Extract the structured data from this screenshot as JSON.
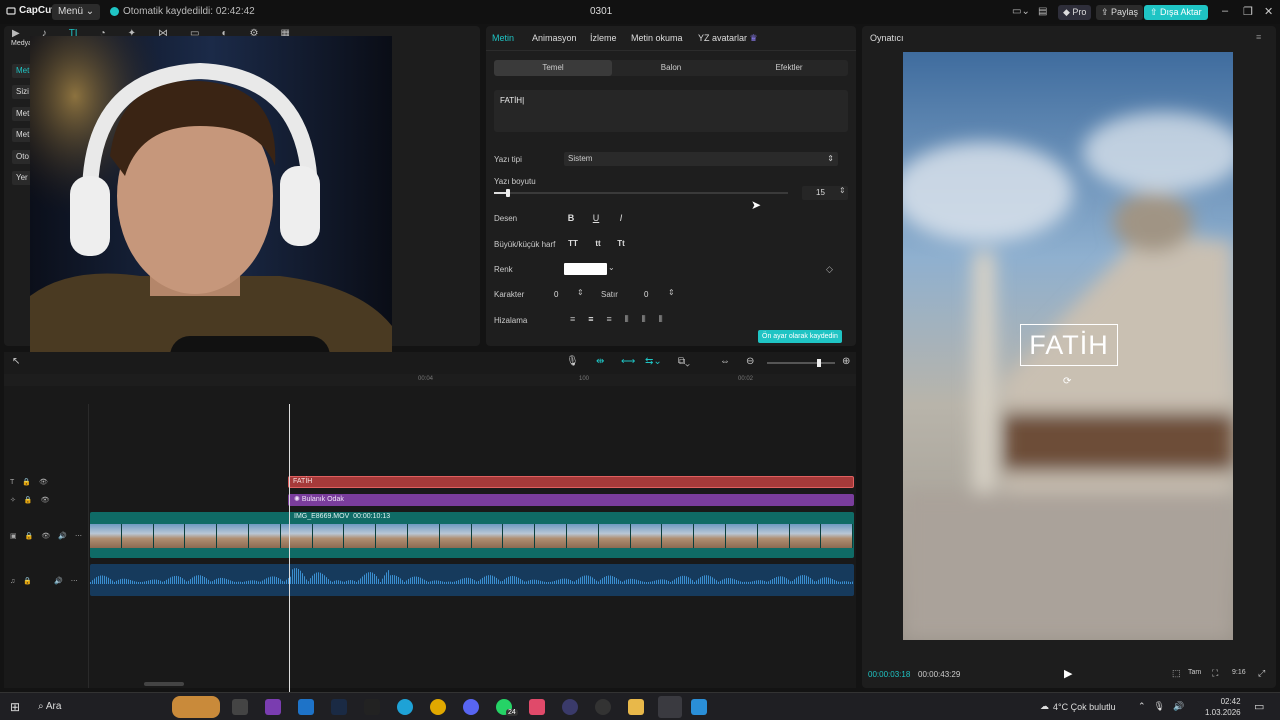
{
  "titlebar": {
    "logo": "CapCut",
    "menu": "Menü",
    "autosave": "Otomatik kaydedildi: 02:42:42",
    "project": "0301",
    "pro": "Pro",
    "share": "Paylaş",
    "export": "Dışa Aktar"
  },
  "leftpanel": {
    "media_label": "Medya",
    "tabs": [
      "Met",
      "Sizi",
      "Met",
      "Met",
      "Oto",
      "Yer"
    ]
  },
  "textpanel": {
    "tabs": [
      "Metin",
      "Animasyon",
      "İzleme",
      "Metin okuma",
      "YZ avatarlar"
    ],
    "subtabs": [
      "Temel",
      "Balon",
      "Efektler"
    ],
    "text_value": "FATİH",
    "font_label": "Yazı tipi",
    "font_value": "Sistem",
    "size_label": "Yazı boyutu",
    "size_value": "15",
    "size_fraction": 0.04,
    "pattern_label": "Desen",
    "case_label": "Büyük/küçük harf",
    "case_opts": [
      "TT",
      "tt",
      "Tt"
    ],
    "color_label": "Renk",
    "char_label": "Karakter",
    "char_value": "0",
    "line_label": "Satır",
    "line_value": "0",
    "align_label": "Hizalama",
    "save_preset": "Ön ayar olarak kaydedin"
  },
  "player": {
    "title": "Oynatıcı",
    "overlay_text": "FATİH",
    "current_time": "00:00:03:18",
    "total_time": "00:00:43:29",
    "btn_full": "Tam",
    "btn_ratio": "9:16"
  },
  "timeline": {
    "ticks": [
      "00:04",
      "100",
      "00:02"
    ],
    "text_clip": "FATİH",
    "effect_clip": "Bulanık Odak",
    "video_clip": "IMG_E8669.MOV",
    "video_duration": "00:00:10:13",
    "zoom_fraction": 0.74
  },
  "taskbar": {
    "search": "Ara",
    "badge": "24",
    "weather": "4°C  Çok bulutlu",
    "time": "02:42",
    "date": "1.03.2026"
  },
  "colors": {
    "accent": "#1fc4c4",
    "text_clip": "#a63a3a",
    "effect_clip": "#7a3d9c",
    "video_clip": "#0f6b66",
    "audio_clip": "#163a5c"
  }
}
